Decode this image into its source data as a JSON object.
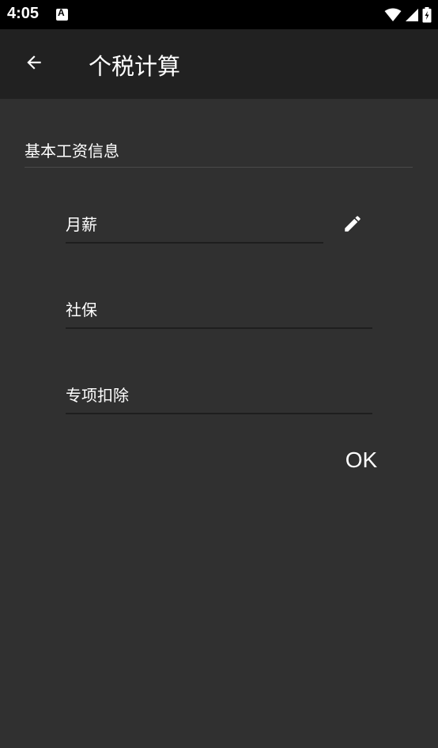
{
  "status_bar": {
    "time": "4:05",
    "notification_icon": "A",
    "icons": [
      "wifi-icon",
      "signal-icon",
      "battery-icon"
    ]
  },
  "app_bar": {
    "title": "个税计算",
    "back_icon": "arrow-left-icon"
  },
  "section": {
    "header": "基本工资信息"
  },
  "fields": {
    "monthly_salary": {
      "label": "月薪"
    },
    "social_insurance": {
      "label": "社保"
    },
    "special_deduction": {
      "label": "专项扣除"
    }
  },
  "actions": {
    "edit_icon": "pencil-icon",
    "ok_label": "OK"
  },
  "colors": {
    "background": "#303030",
    "app_bar": "#212121",
    "status_bar": "#000000",
    "text": "#ffffff"
  }
}
